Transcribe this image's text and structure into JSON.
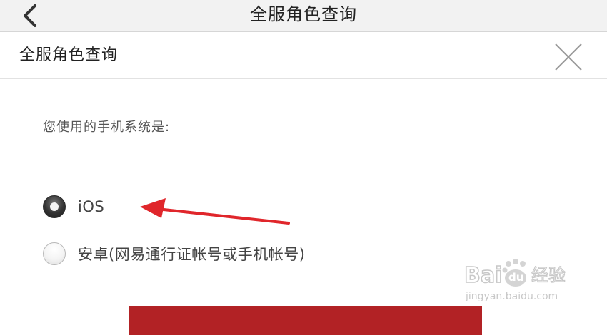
{
  "nav": {
    "title": "全服角色查询",
    "back_icon": "chevron-left-icon"
  },
  "modal": {
    "title": "全服角色查询",
    "close_icon": "close-icon"
  },
  "form": {
    "question": "您使用的手机系统是:",
    "options": [
      {
        "label": "iOS",
        "selected": true
      },
      {
        "label": "安卓(网易通行证帐号或手机帐号)",
        "selected": false
      }
    ]
  },
  "annotation": {
    "arrow_color": "#e0262b"
  },
  "watermark": {
    "brand_left": "Bai",
    "brand_right": "du",
    "brand_cn": "经验",
    "url": "jingyan.baidu.com"
  },
  "colors": {
    "nav_bg": "#f2f2f2",
    "button_red": "#b22225",
    "text_dark": "#222222",
    "text_gray": "#555555"
  }
}
